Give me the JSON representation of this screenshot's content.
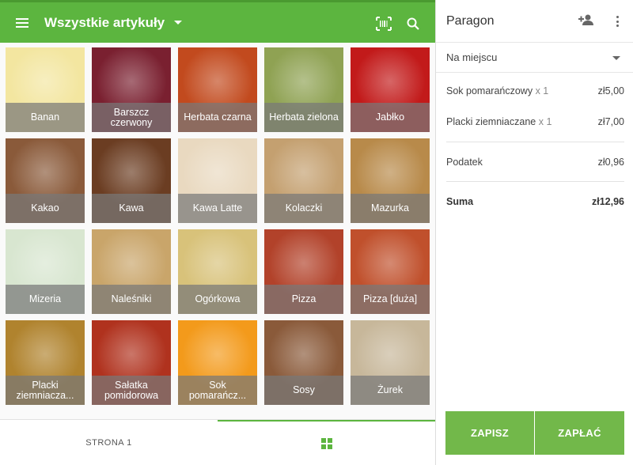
{
  "topbar": {
    "category": "Wszystkie artykuły"
  },
  "products": [
    {
      "name": "Banan",
      "bg": "#f3e6a0"
    },
    {
      "name": "Barszcz czerwony",
      "bg": "#7a2030"
    },
    {
      "name": "Herbata czarna",
      "bg": "#c24a1e"
    },
    {
      "name": "Herbata zielona",
      "bg": "#8fa253"
    },
    {
      "name": "Jabłko",
      "bg": "#c21a1a"
    },
    {
      "name": "Kakao",
      "bg": "#8a5a3a"
    },
    {
      "name": "Kawa",
      "bg": "#6b3d22"
    },
    {
      "name": "Kawa Latte",
      "bg": "#e9d9c0"
    },
    {
      "name": "Kolaczki",
      "bg": "#c4a070"
    },
    {
      "name": "Mazurka",
      "bg": "#b88a4a"
    },
    {
      "name": "Mizeria",
      "bg": "#d8e6d0"
    },
    {
      "name": "Naleśniki",
      "bg": "#c9a56a"
    },
    {
      "name": "Ogórkowa",
      "bg": "#d8c27a"
    },
    {
      "name": "Pizza",
      "bg": "#b2422a"
    },
    {
      "name": "Pizza [duża]",
      "bg": "#c0502c"
    },
    {
      "name": "Placki ziemniacza...",
      "bg": "#b0832e"
    },
    {
      "name": "Sałatka pomidorowa",
      "bg": "#b0321e"
    },
    {
      "name": "Sok pomarańcz...",
      "bg": "#f39a1b"
    },
    {
      "name": "Sosy",
      "bg": "#8a5a3a"
    },
    {
      "name": "Żurek",
      "bg": "#c7b79a"
    }
  ],
  "bottom": {
    "page_label": "STRONA 1"
  },
  "receipt": {
    "title": "Paragon",
    "dine_option": "Na miejscu",
    "items": [
      {
        "name": "Sok pomarańczowy",
        "qty": "x 1",
        "price": "zł5,00"
      },
      {
        "name": "Placki ziemniaczane",
        "qty": "x 1",
        "price": "zł7,00"
      }
    ],
    "tax_label": "Podatek",
    "tax_value": "zł0,96",
    "total_label": "Suma",
    "total_value": "zł12,96",
    "save_label": "ZAPISZ",
    "pay_label": "ZAPŁAĆ"
  },
  "colors": {
    "accent": "#5cb53f",
    "button": "#72b84a"
  }
}
